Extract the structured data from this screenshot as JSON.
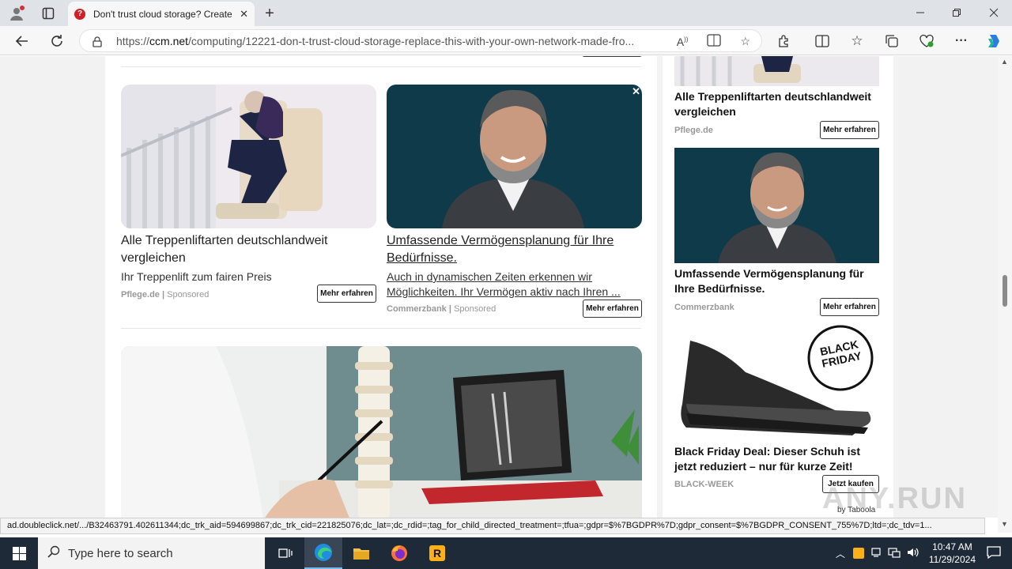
{
  "browser": {
    "tab_title": "Don't trust cloud storage? Create",
    "url_prefix": "https://",
    "url_host": "ccm.net",
    "url_path": "/computing/12221-don-t-trust-cloud-storage-replace-this-with-your-own-network-made-fro..."
  },
  "main": {
    "card1": {
      "headline": "Alle Treppenliftarten deutschlandweit vergleichen",
      "desc": "Ihr Treppenlift zum fairen Preis",
      "source": "Pflege.de",
      "sponsored": "Sponsored",
      "button": "Mehr erfahren"
    },
    "card2": {
      "headline": "Umfassende Vermögensplanung für Ihre Bedürfnisse.",
      "desc": "Auch in dynamischen Zeiten erkennen wir Möglichkeiten. Ihr Vermögen aktiv nach Ihren ...",
      "source": "Commerzbank",
      "sponsored": "Sponsored",
      "button": "Mehr erfahren",
      "close": "✕"
    }
  },
  "sidebar": {
    "ad1": {
      "title": "Alle Treppenliftarten deutschlandweit vergleichen",
      "source": "Pflege.de",
      "button": "Mehr erfahren"
    },
    "ad2": {
      "title": "Umfassende Vermögensplanung für Ihre Bedürfnisse.",
      "source": "Commerzbank",
      "button": "Mehr erfahren"
    },
    "ad3": {
      "title": "Black Friday Deal: Dieser Schuh ist jetzt reduziert – nur für kurze Zeit!",
      "source": "BLACK-WEEK",
      "button": "Jetzt kaufen",
      "badge_line1": "BLACK",
      "badge_line2": "FRIDAY"
    },
    "taboola": "by Taboola"
  },
  "statusbar": {
    "text": "ad.doubleclick.net/.../B32463791.402611344;dc_trk_aid=594699867;dc_trk_cid=221825076;dc_lat=;dc_rdid=;tag_for_child_directed_treatment=;tfua=;gdpr=$%7BGDPR%7D;gdpr_consent=$%7BGDPR_CONSENT_755%7D;ltd=;dc_tdv=1..."
  },
  "watermark": "ANY.RUN",
  "taskbar": {
    "search_placeholder": "Type here to search",
    "time": "10:47 AM",
    "date": "11/29/2024"
  }
}
